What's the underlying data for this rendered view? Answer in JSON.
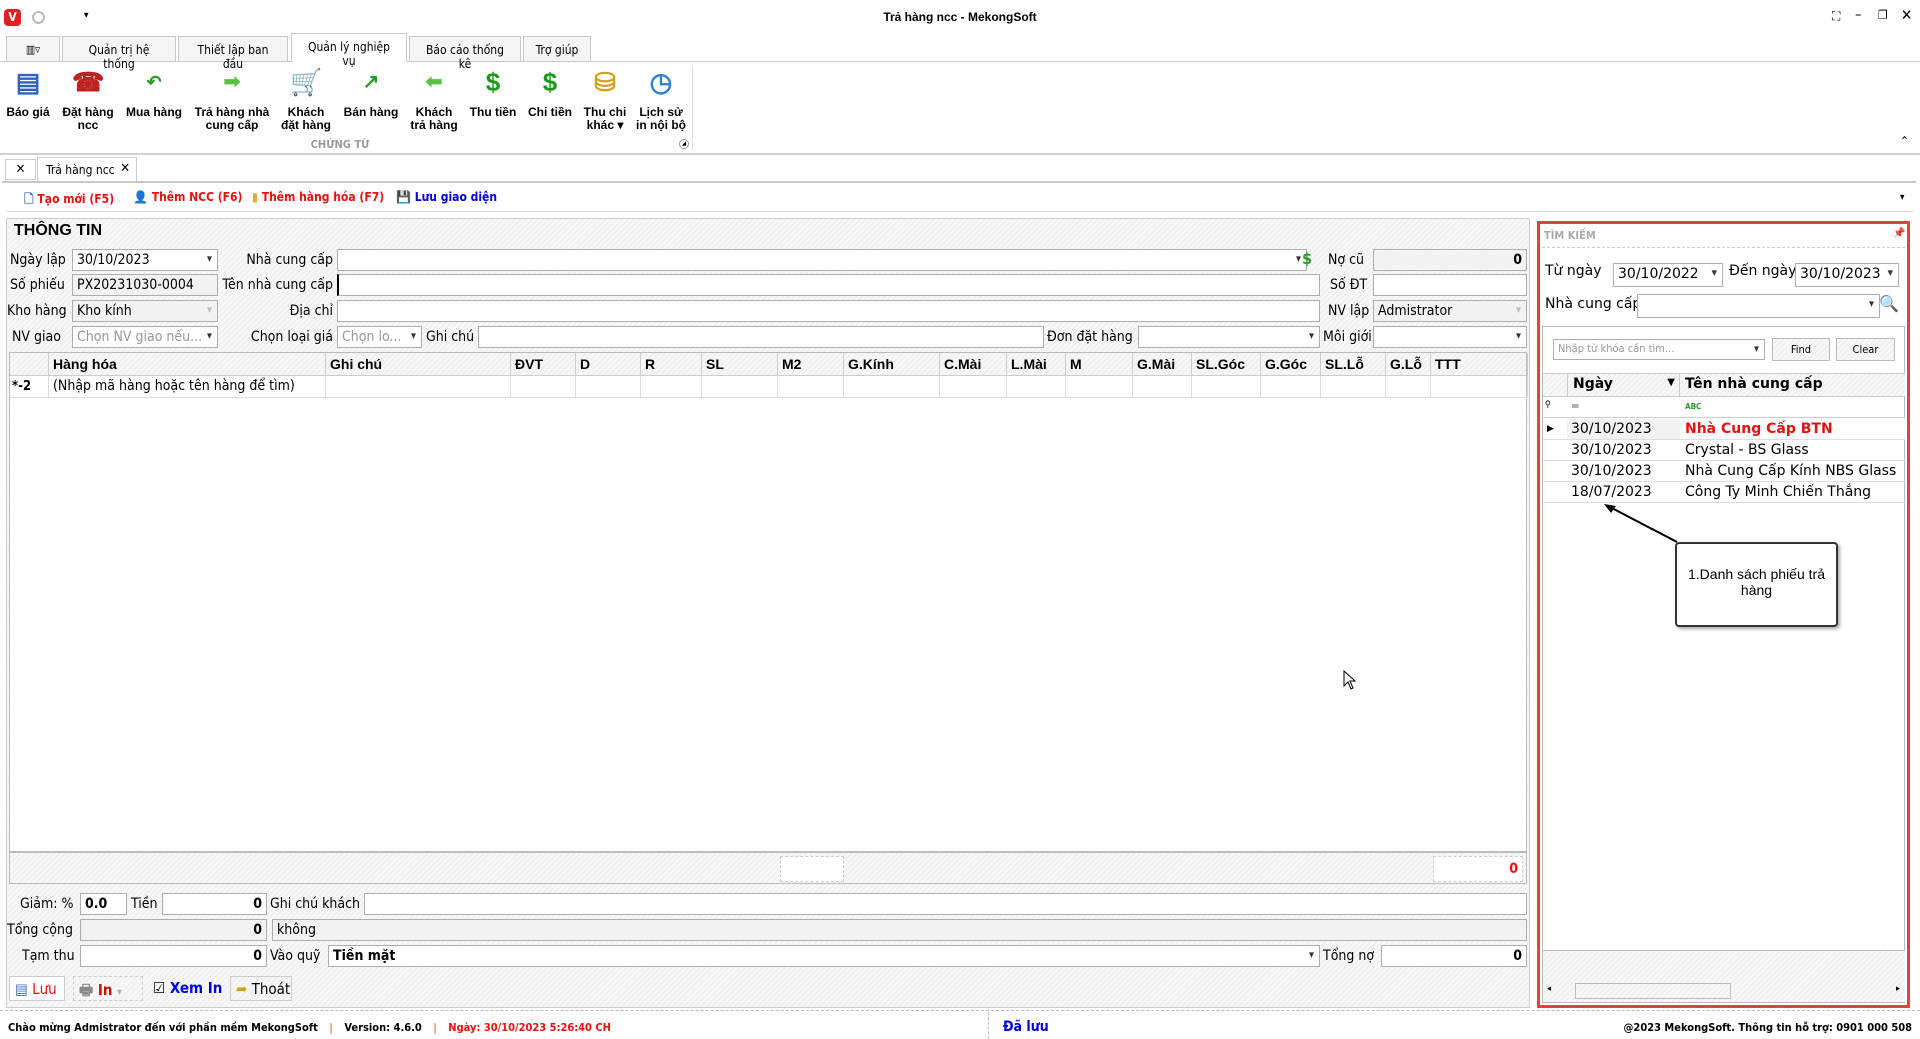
{
  "window": {
    "title": "Trả hàng ncc - MekongSoft"
  },
  "ribbon": {
    "tabs": [
      "Quản trị hệ thống",
      "Thiết lập ban đầu",
      "Quản lý nghiệp vụ",
      "Báo cáo thống kê",
      "Trợ giúp"
    ],
    "group_label": "CHỨNG TỪ",
    "buttons": [
      {
        "l1": "Báo giá",
        "l2": ""
      },
      {
        "l1": "Đặt hàng",
        "l2": "ncc"
      },
      {
        "l1": "Mua hàng",
        "l2": ""
      },
      {
        "l1": "Trả hàng nhà",
        "l2": "cung cấp"
      },
      {
        "l1": "Khách",
        "l2": "đặt hàng"
      },
      {
        "l1": "Bán hàng",
        "l2": ""
      },
      {
        "l1": "Khách",
        "l2": "trả hàng"
      },
      {
        "l1": "Thu tiền",
        "l2": ""
      },
      {
        "l1": "Chi tiền",
        "l2": ""
      },
      {
        "l1": "Thu chi",
        "l2": "khác ▾"
      },
      {
        "l1": "Lịch sử",
        "l2": "in nội bộ"
      }
    ]
  },
  "doc_tab": {
    "label": "Trả hàng ncc"
  },
  "toolbar": {
    "new": "Tạo mới (F5)",
    "add_supplier": "Thêm NCC (F6)",
    "add_item": "Thêm hàng hóa (F7)",
    "save_layout": "Lưu giao diện"
  },
  "form": {
    "section_title": "THÔNG TIN",
    "ngay_lap_label": "Ngày lập",
    "ngay_lap": "30/10/2023",
    "so_phieu_label": "Số phiếu",
    "so_phieu": "PX20231030-0004",
    "kho_hang_label": "Kho hàng",
    "kho_hang": "Kho kính",
    "nv_giao_label": "NV giao",
    "nv_giao_placeholder": "Chọn NV giao nếu...",
    "ncc_label": "Nhà cung cấp",
    "ncc": "",
    "ten_ncc_label": "Tên nhà cung cấp",
    "ten_ncc": "",
    "dia_chi_label": "Địa chỉ",
    "dia_chi": "",
    "loai_gia_label": "Chọn loại giá",
    "loai_gia_placeholder": "Chọn lo...",
    "ghi_chu_label": "Ghi chú",
    "ghi_chu": "",
    "don_dat_hang_label": "Đơn đặt hàng",
    "no_cu_label": "Nợ cũ",
    "no_cu": "0",
    "so_dt_label": "Số ĐT",
    "so_dt": "",
    "nv_lap_label": "NV lập",
    "nv_lap": "Admistrator",
    "moi_gioi_label": "Môi giới"
  },
  "grid": {
    "columns": [
      "Hàng hóa",
      "Ghi chú",
      "ĐVT",
      "D",
      "R",
      "SL",
      "M2",
      "G.Kính",
      "C.Mài",
      "L.Mài",
      "M",
      "G.Mài",
      "SL.Góc",
      "G.Góc",
      "SL.Lỗ",
      "G.Lỗ",
      "TTT"
    ],
    "new_row_indicator": "*-2",
    "new_row_placeholder": "(Nhập mã hàng hoặc tên hàng để tìm)",
    "footer_total": "0"
  },
  "summary": {
    "giam_label": "Giảm: %",
    "giam": "0.0",
    "tien_label": "Tiền",
    "tien": "0",
    "ghi_chu_khach_label": "Ghi chú khách",
    "ghi_chu_khach": "",
    "tong_cong_label": "Tổng cộng",
    "tong_cong": "0",
    "bang_chu": "không",
    "tam_thu_label": "Tạm thu",
    "tam_thu": "0",
    "vao_quy_label": "Vào quỹ",
    "vao_quy": "Tiền mặt",
    "tong_no_label": "Tổng nợ",
    "tong_no": "0"
  },
  "actions": {
    "save": "Lưu",
    "print": "In",
    "preview": "Xem In",
    "exit": "Thoát"
  },
  "search": {
    "title": "TÌM KIẾM",
    "from_label": "Từ ngày",
    "from": "30/10/2022",
    "to_label": "Đến ngày",
    "to": "30/10/2023",
    "ncc_label": "Nhà cung cấp",
    "keyword_placeholder": "Nhập từ khóa cần tìm...",
    "find": "Find",
    "clear": "Clear",
    "columns": [
      "Ngày",
      "Tên nhà cung cấp"
    ],
    "rows": [
      {
        "date": "30/10/2023",
        "name": "Nhà Cung Cấp BTN"
      },
      {
        "date": "30/10/2023",
        "name": "Crystal - BS Glass"
      },
      {
        "date": "30/10/2023",
        "name": "Nhà Cung Cấp Kính NBS Glass"
      },
      {
        "date": "18/07/2023",
        "name": "Công Ty Minh Chiến Thắng"
      }
    ],
    "callout": "1.Danh sách phiếu trả hàng"
  },
  "status": {
    "welcome": "Chào mừng Admistrator đến với phần mềm MekongSoft",
    "version": "Version: 4.6.0",
    "date": "Ngày: 30/10/2023 5:26:40 CH",
    "saved": "Đã lưu",
    "support": "@2023 MekongSoft. Thông tin hỗ trợ: 0901 000 508"
  },
  "colors": {
    "accent_red": "#e81010",
    "link_blue": "#0000dd",
    "highlight_border": "#e84040"
  }
}
